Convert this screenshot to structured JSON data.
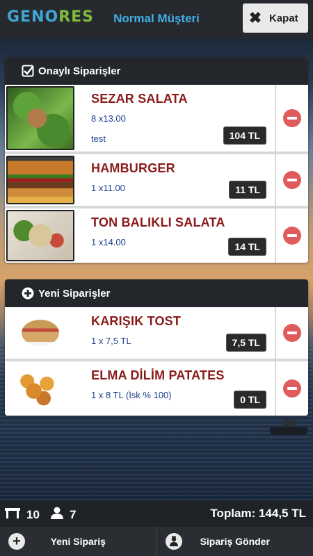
{
  "header": {
    "logo_part1": "GENO",
    "logo_part2": "RES",
    "title": "Normal Müşteri",
    "close_label": "Kapat"
  },
  "approved": {
    "title": "Onaylı Siparişler",
    "items": [
      {
        "name": "SEZAR SALATA",
        "qty": "8 x13.00",
        "note": "test",
        "price": "104 TL",
        "image": "caesar-salad"
      },
      {
        "name": "HAMBURGER",
        "qty": "1 x11.00",
        "note": "",
        "price": "11 TL",
        "image": "hamburger"
      },
      {
        "name": "TON BALIKLI SALATA",
        "qty": "1 x14.00",
        "note": "",
        "price": "14 TL",
        "image": "tuna-salad"
      }
    ]
  },
  "new_orders": {
    "title": "Yeni Siparişler",
    "items": [
      {
        "name": "KARIŞIK TOST",
        "qty": "1 x 7,5 TL",
        "note": "",
        "price": "7,5 TL",
        "image": "mixed-toast"
      },
      {
        "name": "ELMA DİLİM PATATES",
        "qty": "1 x 8 TL (İsk % 100)",
        "note": "",
        "price": "0 TL",
        "image": "potato-wedges"
      }
    ]
  },
  "status": {
    "table_number": "10",
    "guest_count": "7",
    "total": "Toplam: 144,5 TL"
  },
  "toolbar": {
    "new_order_label": "Yeni Sipariş",
    "send_order_label": "Sipariş Gönder"
  }
}
